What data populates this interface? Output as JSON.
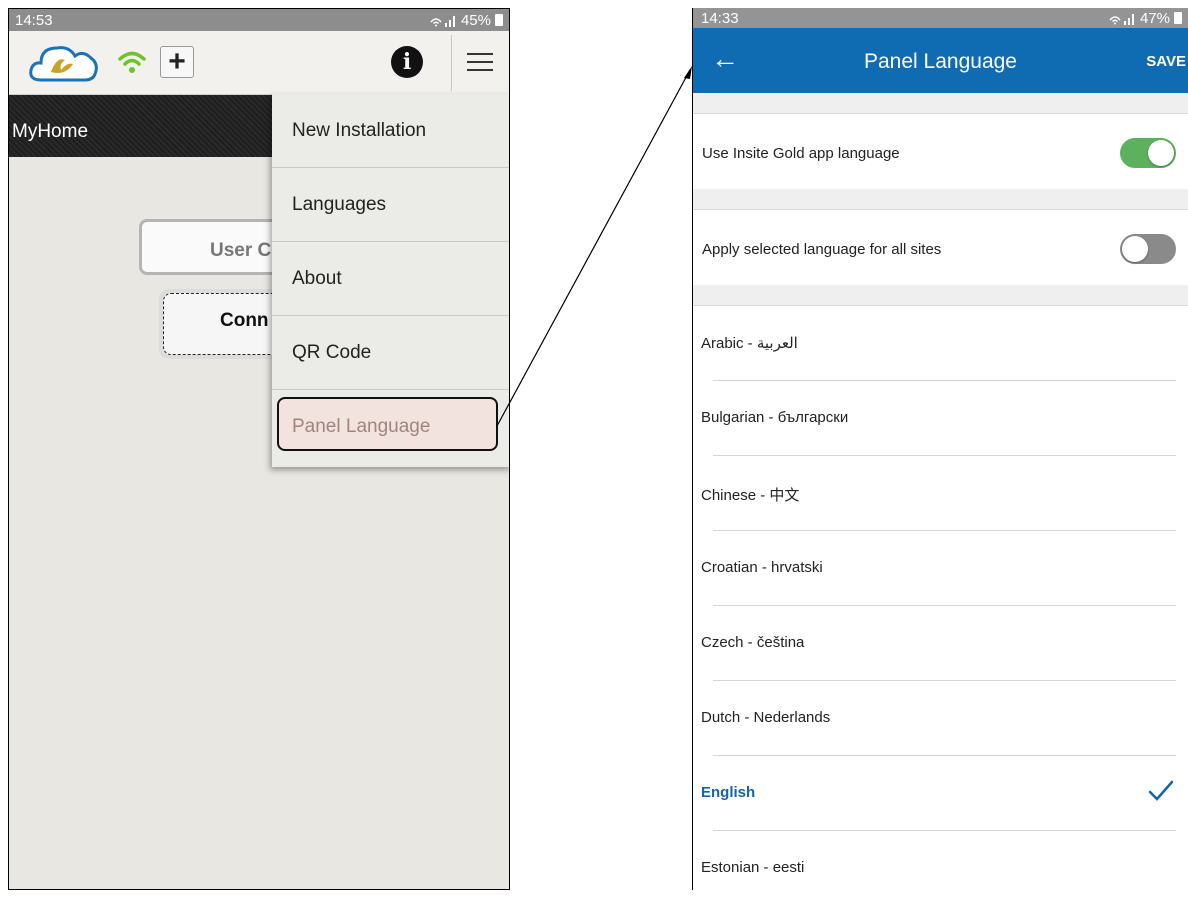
{
  "left_screen": {
    "status_bar": {
      "time": "14:53",
      "battery": "45%"
    },
    "toolbar": {
      "plus_label": "+",
      "info_label": "i"
    },
    "site_title": "MyHome",
    "user_code_placeholder": "User C",
    "connect_label": "Conn",
    "menu": {
      "items": [
        "New Installation",
        "Languages",
        "About",
        "QR Code",
        "Panel Language"
      ],
      "highlighted": "Panel Language"
    }
  },
  "right_screen": {
    "status_bar": {
      "time": "14:33",
      "battery": "47%"
    },
    "app_bar": {
      "back": "←",
      "title": "Panel Language",
      "save": "SAVE"
    },
    "settings": [
      {
        "label": "Use Insite Gold app language",
        "enabled": true
      },
      {
        "label": "Apply selected language for all sites",
        "enabled": false
      }
    ],
    "languages": [
      {
        "label": "Arabic - العربية",
        "selected": false
      },
      {
        "label": "Bulgarian - български",
        "selected": false
      },
      {
        "label": "Chinese - 中文",
        "selected": false
      },
      {
        "label": "Croatian - hrvatski",
        "selected": false
      },
      {
        "label": "Czech - čeština",
        "selected": false
      },
      {
        "label": "Dutch - Nederlands",
        "selected": false
      },
      {
        "label": "English",
        "selected": true
      },
      {
        "label": "Estonian - eesti",
        "selected": false
      }
    ]
  },
  "colors": {
    "accent_blue": "#0f6cb3",
    "toggle_on": "#5cb25c",
    "toggle_off": "#8a8a8a",
    "selected_text": "#1565a8",
    "highlight_fill": "#f2e3df"
  },
  "icons": [
    "logo-icon",
    "wifi-icon",
    "signal-icon",
    "battery-icon",
    "plus-icon",
    "info-icon",
    "hamburger-menu-icon",
    "back-arrow-icon",
    "checkmark-icon"
  ]
}
